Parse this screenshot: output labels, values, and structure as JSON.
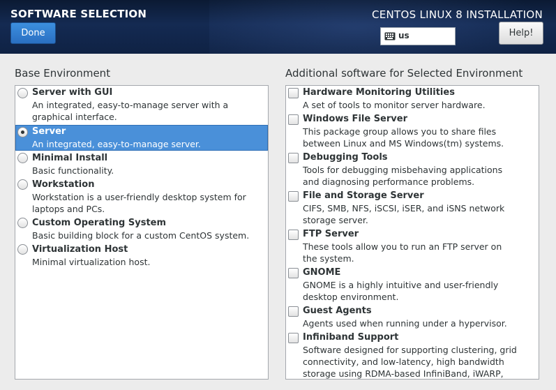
{
  "header": {
    "title": "SOFTWARE SELECTION",
    "product": "CENTOS LINUX 8 INSTALLATION",
    "done_label": "Done",
    "help_label": "Help!",
    "keyboard_layout": "us"
  },
  "base_environment": {
    "title": "Base Environment",
    "selected": "Server",
    "items": [
      {
        "name": "Server with GUI",
        "desc": "An integrated, easy-to-manage server with a graphical interface.",
        "selected": false
      },
      {
        "name": "Server",
        "desc": "An integrated, easy-to-manage server.",
        "selected": true
      },
      {
        "name": "Minimal Install",
        "desc": "Basic functionality.",
        "selected": false
      },
      {
        "name": "Workstation",
        "desc": "Workstation is a user-friendly desktop system for laptops and PCs.",
        "selected": false
      },
      {
        "name": "Custom Operating System",
        "desc": "Basic building block for a custom CentOS system.",
        "selected": false
      },
      {
        "name": "Virtualization Host",
        "desc": "Minimal virtualization host.",
        "selected": false
      }
    ]
  },
  "additional_software": {
    "title": "Additional software for Selected Environment",
    "items": [
      {
        "name": "Hardware Monitoring Utilities",
        "desc": "A set of tools to monitor server hardware.",
        "checked": false
      },
      {
        "name": "Windows File Server",
        "desc": "This package group allows you to share files between Linux and MS Windows(tm) systems.",
        "checked": false
      },
      {
        "name": "Debugging Tools",
        "desc": "Tools for debugging misbehaving applications and diagnosing performance problems.",
        "checked": false
      },
      {
        "name": "File and Storage Server",
        "desc": "CIFS, SMB, NFS, iSCSI, iSER, and iSNS network storage server.",
        "checked": false
      },
      {
        "name": "FTP Server",
        "desc": "These tools allow you to run an FTP server on the system.",
        "checked": false
      },
      {
        "name": "GNOME",
        "desc": "GNOME is a highly intuitive and user-friendly desktop environment.",
        "checked": false
      },
      {
        "name": "Guest Agents",
        "desc": "Agents used when running under a hypervisor.",
        "checked": false
      },
      {
        "name": "Infiniband Support",
        "desc": "Software designed for supporting clustering, grid connectivity, and low-latency, high bandwidth storage using RDMA-based InfiniBand, iWARP, RoCE, and OPA",
        "checked": false
      }
    ]
  },
  "colors": {
    "accent": "#4a90d9",
    "header_bg": "#142a52"
  },
  "icons": {
    "keyboard": "keyboard-icon"
  }
}
